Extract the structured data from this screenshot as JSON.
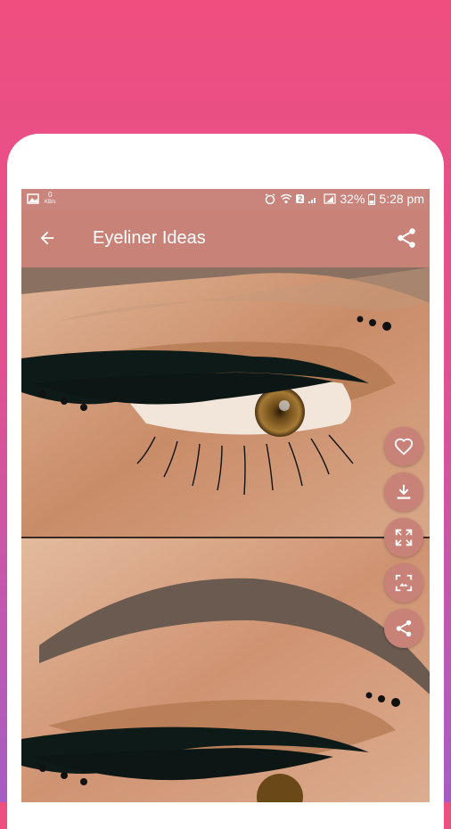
{
  "status_bar": {
    "left_counter": "0",
    "left_unit": "KB/s",
    "sim_badge": "2",
    "battery": "32%",
    "time": "5:28 pm"
  },
  "app_bar": {
    "title": "Eyeliner Ideas",
    "back_icon": "arrow-back-icon",
    "share_icon": "share-icon"
  },
  "fab_actions": [
    {
      "icon": "heart-outline-icon",
      "action": "favorite"
    },
    {
      "icon": "download-icon",
      "action": "download"
    },
    {
      "icon": "fullscreen-icon",
      "action": "fullscreen"
    },
    {
      "icon": "set-wallpaper-icon",
      "action": "set-as-wallpaper"
    },
    {
      "icon": "share-icon",
      "action": "share"
    }
  ],
  "colors": {
    "accent": "#c98278",
    "background_top": "#ee4f7f",
    "background_bottom": "#a65cc4"
  }
}
